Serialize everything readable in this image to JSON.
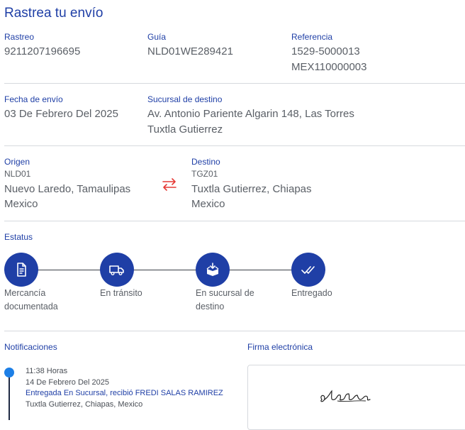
{
  "page": {
    "title": "Rastrea tu envío"
  },
  "info": {
    "tracking_label": "Rastreo",
    "tracking_value": "9211207196695",
    "guide_label": "Guía",
    "guide_value": "NLD01WE289421",
    "reference_label": "Referencia",
    "reference_value_1": "1529-5000013",
    "reference_value_2": "MEX110000003",
    "ship_date_label": "Fecha de envío",
    "ship_date_value": "03 De Febrero Del 2025",
    "branch_label": "Sucursal de destino",
    "branch_line_1": "Av. Antonio Pariente Algarin 148, Las Torres",
    "branch_line_2": "Tuxtla Gutierrez"
  },
  "route": {
    "origin_label": "Origen",
    "origin_code": "NLD01",
    "origin_city": "Nuevo Laredo, Tamaulipas",
    "origin_country": "Mexico",
    "dest_label": "Destino",
    "dest_code": "TGZ01",
    "dest_city": "Tuxtla Gutierrez, Chiapas",
    "dest_country": "Mexico",
    "swap_icon": "swap-arrows-icon"
  },
  "status": {
    "label": "Estatus",
    "steps": [
      {
        "icon": "document-icon",
        "line1": "Mercancía",
        "line2": "documentada"
      },
      {
        "icon": "truck-icon",
        "line1": "En tránsito",
        "line2": ""
      },
      {
        "icon": "package-icon",
        "line1": "En sucursal de",
        "line2": "destino"
      },
      {
        "icon": "double-check-icon",
        "line1": "Entregado",
        "line2": ""
      }
    ]
  },
  "notifications": {
    "label": "Notificaciones",
    "items": [
      {
        "time": "11:38 Horas",
        "date": "14 De Febrero Del 2025",
        "message": "Entregada En Sucursal, recibió FREDI SALAS RAMIREZ",
        "location": "Tuxtla Gutierrez, Chiapas, Mexico"
      }
    ]
  },
  "signature": {
    "label": "Firma electrónica"
  },
  "colors": {
    "primary": "#1f3fa6",
    "accent_red": "#e53935",
    "timeline_dot": "#1d7fe6"
  }
}
